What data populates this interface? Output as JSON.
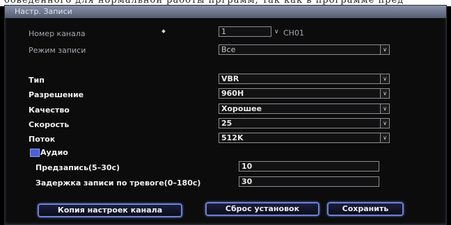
{
  "overlay_text": "ооведенного для нормальной работы прграмм, так как в программе пред",
  "window": {
    "title": "Настр. Записи"
  },
  "channel": {
    "label": "Номер канала",
    "value": "1",
    "name": "CH01"
  },
  "record_mode": {
    "label": "Режим записи",
    "value": "Все"
  },
  "type": {
    "label": "Тип",
    "value": "VBR"
  },
  "resolution": {
    "label": "Разрешение",
    "value": "960H"
  },
  "quality": {
    "label": "Качество",
    "value": "Хорошее"
  },
  "speed": {
    "label": "Скорость",
    "value": "25"
  },
  "stream": {
    "label": "Поток",
    "value": "512K"
  },
  "audio": {
    "label": "Аудио",
    "checked": true
  },
  "prerecord": {
    "label": "Предзапись(5–30с)",
    "value": "10"
  },
  "alarm_delay": {
    "label": "Задержка записи по тревоге(0–180с)",
    "value": "30"
  },
  "buttons": {
    "copy": "Копия настроек канала",
    "reset": "Сброс установок",
    "save": "Сохранить"
  },
  "icons": {
    "dropdown": "chevron-down-icon",
    "checkbox": "checkbox-icon",
    "cursor": "mouse-cursor-icon"
  },
  "colors": {
    "background": "#0c0c0c",
    "titlebar": "#6d7489",
    "button_border": "#6e82d4",
    "checkbox": "#4a5fd8"
  }
}
